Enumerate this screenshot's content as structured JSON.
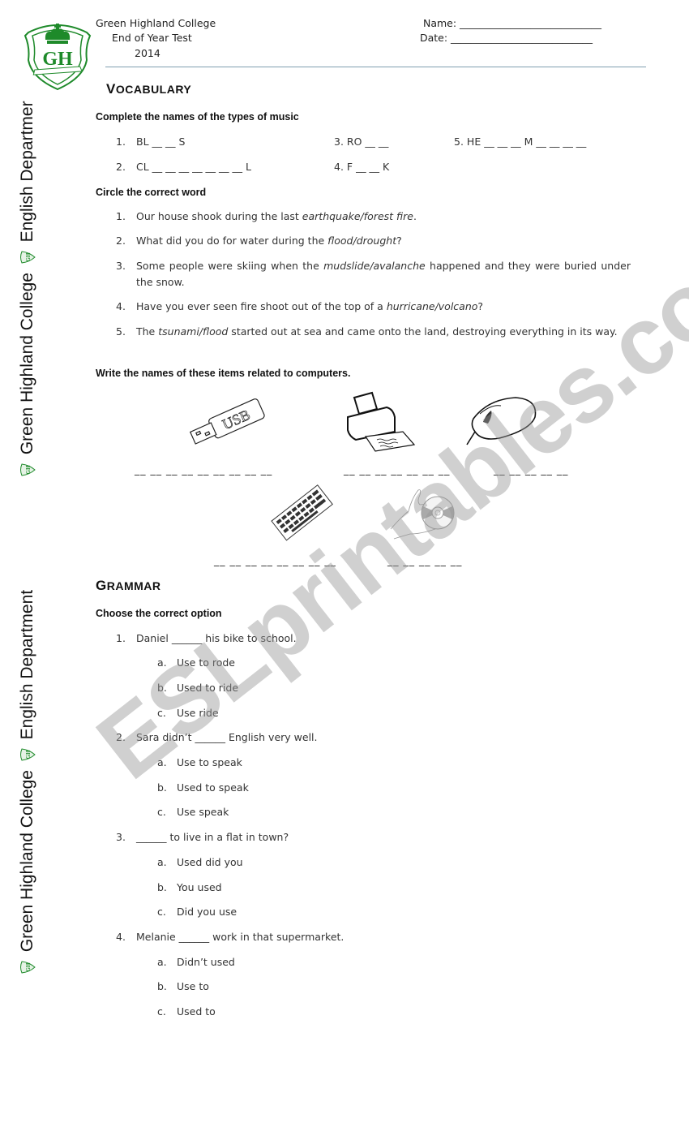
{
  "header": {
    "school": "Green Highland College",
    "test": "End of Year Test",
    "year": "2014",
    "name_label": "Name: ____________________________",
    "date_label": "Date: ____________________________",
    "logo_text": "GH",
    "brand_color": "#1e8a2a"
  },
  "sidebar": {
    "top_text_1": "Green Highland College",
    "top_text_2": "English Departmer",
    "bottom_text_1": "Green Highland College",
    "bottom_text_2": "English Department"
  },
  "vocabulary": {
    "title_cap": "V",
    "title_rest": "OCABULARY",
    "music": {
      "instruction": "Complete the names of the types of music",
      "items": [
        {
          "num": "1.",
          "text": "BL __ __ S"
        },
        {
          "num": "2.",
          "text": "CL __ __ __ __ __ __ __ L"
        },
        {
          "num": "3.",
          "text": "RO __ __"
        },
        {
          "num": "4.",
          "text": "F __ __ K"
        },
        {
          "num": "5.",
          "text": "HE __ __ __ M __ __ __ __"
        }
      ]
    },
    "circle": {
      "instruction": "Circle the correct word",
      "items": [
        {
          "num": "1.",
          "before": "Our house shook during the last ",
          "choice": "earthquake/forest fire",
          "after": "."
        },
        {
          "num": "2.",
          "before": "What did you do for water during the ",
          "choice": "flood/drought",
          "after": "?"
        },
        {
          "num": "3.",
          "before": "Some people were skiing when the ",
          "choice": "mudslide/avalanche",
          "after": " happened and they were buried under the snow."
        },
        {
          "num": "4.",
          "before": "Have you ever seen fire shoot out of the top of a ",
          "choice": "hurricane/volcano",
          "after": "?"
        },
        {
          "num": "5.",
          "before": "The ",
          "choice": "tsunami/flood",
          "after": " started out at sea and came onto the land, destroying everything in its way."
        }
      ]
    },
    "computers": {
      "instruction": "Write the names of these items related to computers.",
      "items": [
        {
          "icon": "usb-flash-drive-icon",
          "blank": "__ __ __  __ __ __ __ __ __"
        },
        {
          "icon": "printer-icon",
          "blank": "__ __ __ __ __ __ __"
        },
        {
          "icon": "mouse-icon",
          "blank": "__ __ __ __ __"
        },
        {
          "icon": "keyboard-icon",
          "blank": "__ __ __ __ __ __ __ __"
        },
        {
          "icon": "cd-rom-icon",
          "blank": "__ __  __ __ __"
        }
      ]
    }
  },
  "grammar": {
    "title_cap": "G",
    "title_rest": "RAMMAR",
    "instruction": "Choose the correct option",
    "questions": [
      {
        "num": "1.",
        "text": "Daniel ______ his bike to school.",
        "options": [
          {
            "letter": "a.",
            "text": "Use to rode"
          },
          {
            "letter": "b.",
            "text": "Used to ride"
          },
          {
            "letter": "c.",
            "text": "Use ride"
          }
        ]
      },
      {
        "num": "2.",
        "text": "Sara didn’t ______ English very well.",
        "options": [
          {
            "letter": "a.",
            "text": "Use to speak"
          },
          {
            "letter": "b.",
            "text": "Used to speak"
          },
          {
            "letter": "c.",
            "text": "Use speak"
          }
        ]
      },
      {
        "num": "3.",
        "text": "______ to live in a flat in town?",
        "options": [
          {
            "letter": "a.",
            "text": "Used did you"
          },
          {
            "letter": "b.",
            "text": "You used"
          },
          {
            "letter": "c.",
            "text": "Did you use"
          }
        ]
      },
      {
        "num": "4.",
        "text": "Melanie ______ work in that supermarket.",
        "options": [
          {
            "letter": "a.",
            "text": "Didn’t used"
          },
          {
            "letter": "b.",
            "text": "Use to"
          },
          {
            "letter": "c.",
            "text": "Used to"
          }
        ]
      }
    ]
  },
  "watermark": "ESLprintables.com"
}
